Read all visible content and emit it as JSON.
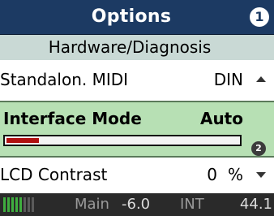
{
  "title": {
    "label": "Options",
    "badge": "1"
  },
  "subheader": {
    "label": "Hardware/Diagnosis"
  },
  "rows": {
    "midi": {
      "label": "Standalon. MIDI",
      "value": "DIN",
      "arrow_icon": "arrow-up-icon"
    },
    "interface": {
      "label": "Interface Mode",
      "value": "Auto",
      "progress_fraction": 0.14,
      "badge": "2"
    },
    "lcd": {
      "label": "LCD Contrast",
      "value": "0",
      "unit": "%",
      "arrow_icon": "arrow-down-icon"
    }
  },
  "status": {
    "meter_segments_total": 8,
    "meter_segments_lit": 5,
    "main_label": "Main",
    "level": "-6.0",
    "int_label": "INT",
    "rate": "44.1"
  },
  "colors": {
    "title_bg": "#1c3a63",
    "subheader_bg": "#c9d9d5",
    "selected_row_bg": "#b7e0b4",
    "progress_fill": "#b01010",
    "status_bg": "#2a2a2a",
    "meter_lit": "#3fae3f",
    "meter_dim": "#5a5a5a"
  }
}
